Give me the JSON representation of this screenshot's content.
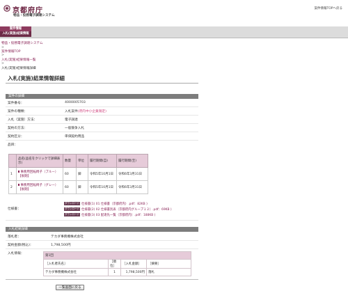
{
  "header": {
    "logo_title": "京都府庁",
    "logo_subtitle": "物品・役務電子調達システム",
    "top_link": "案件情報TOPへ戻る"
  },
  "nav": {
    "tabs": [
      {
        "label": "案件情報"
      },
      {
        "label": "入札(実施)結果情報"
      }
    ]
  },
  "breadcrumb": {
    "items": [
      {
        "label": "物品・役務電子調達システム"
      },
      {
        "label": "案件情報TOP"
      },
      {
        "label": "入札(実施)結果情報一覧"
      },
      {
        "label": "入札(実施)結果情報詳細"
      }
    ],
    "separator": ">"
  },
  "page_title": "入札(実施)結果情報詳細",
  "case": {
    "section_title": "案件の詳細",
    "fields": [
      {
        "label": "案件番号：",
        "value": "4000005703"
      },
      {
        "label": "案件の種類：",
        "value": "入札案件",
        "note": "(府内中小企業限定)"
      },
      {
        "label": "入札（実施）方法：",
        "value": "電子調達"
      },
      {
        "label": "契約の方法：",
        "value": "一般競争入札"
      },
      {
        "label": "契約区分：",
        "value": "単価契約用品"
      },
      {
        "label": "品目：",
        "value": ""
      }
    ],
    "items_table": {
      "headers": [
        "",
        "品名(品名をクリックで詳細表示)",
        "数量",
        "単位",
        "履行期間(自)",
        "履行期間(至)"
      ],
      "rows": [
        {
          "no": "1",
          "name": "事務用回転椅子（ブルー）",
          "sub": "【後期】",
          "qty": "60",
          "unit": "脚",
          "from": "令和5年10月1日",
          "to": "令和6年3月31日"
        },
        {
          "no": "2",
          "name": "事務用回転椅子（グレー）",
          "sub": "【後期】",
          "qty": "60",
          "unit": "脚",
          "from": "令和5年10月1日",
          "to": "令和6年3月31日"
        }
      ]
    },
    "spec_label": "仕様書：",
    "spec_badge": "ダウンロード",
    "specs": [
      {
        "label": "仕様書(1) 01 仕様書（京都府内）.pdf：82KB )"
      },
      {
        "label": "仕様書(2) 02 仕様書別表（京都府内グループ１２）.pdf：69KB )"
      },
      {
        "label": "仕様書(3) 03 配達先一覧（京都府内）.pdf：188KB )"
      }
    ]
  },
  "result": {
    "section_title": "入札結果詳細",
    "winner_label": "落札者：",
    "winner": "テカダ事務機株式会社",
    "amount_label": "契約金額(税込)：",
    "amount": "1,798,500円",
    "info_label": "入札情報：",
    "round_label": "第1回",
    "table_headers": [
      "［入札者氏名］",
      "［順位］",
      "［入札金額］",
      "［摘要］"
    ],
    "table_rows": [
      {
        "name": "テカダ事務機株式会社",
        "rank": "1",
        "price": "1,798,500円",
        "note": "落札"
      }
    ]
  },
  "back_button_label": "一覧画面に戻る"
}
